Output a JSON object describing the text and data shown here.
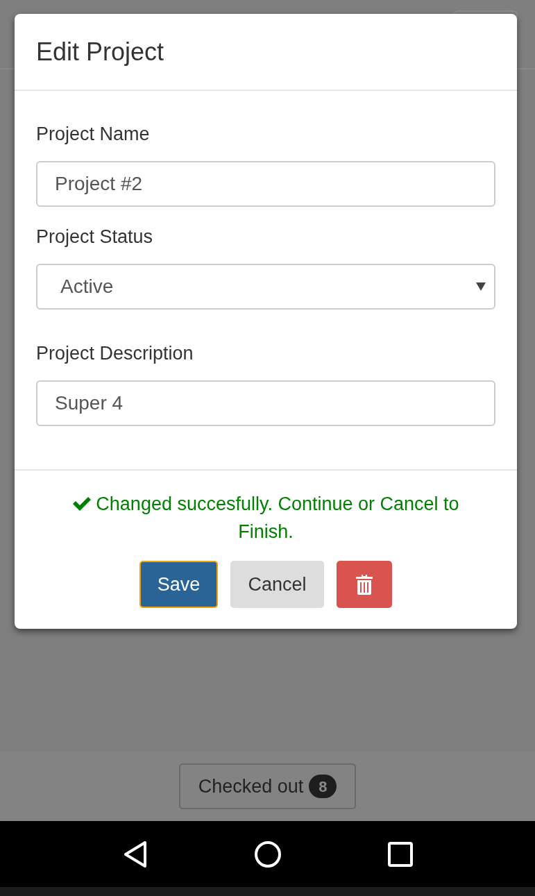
{
  "dialog": {
    "title": "Edit Project",
    "fields": [
      {
        "kind": "text",
        "label": "Project Name",
        "value": "Project #2"
      },
      {
        "kind": "select",
        "label": "Project Status",
        "value": "Active"
      },
      {
        "kind": "text",
        "label": "Project Description",
        "value": "Super 4"
      }
    ],
    "message": "Changed succesfully. Continue or Cancel to Finish.",
    "buttons": [
      {
        "kind": "primary",
        "label": "Save",
        "focused": true
      },
      {
        "kind": "default",
        "label": "Cancel",
        "focused": false
      },
      {
        "kind": "danger",
        "focused": false
      }
    ]
  },
  "footer": {
    "button": {
      "label": "Checked out",
      "count": "8"
    }
  }
}
